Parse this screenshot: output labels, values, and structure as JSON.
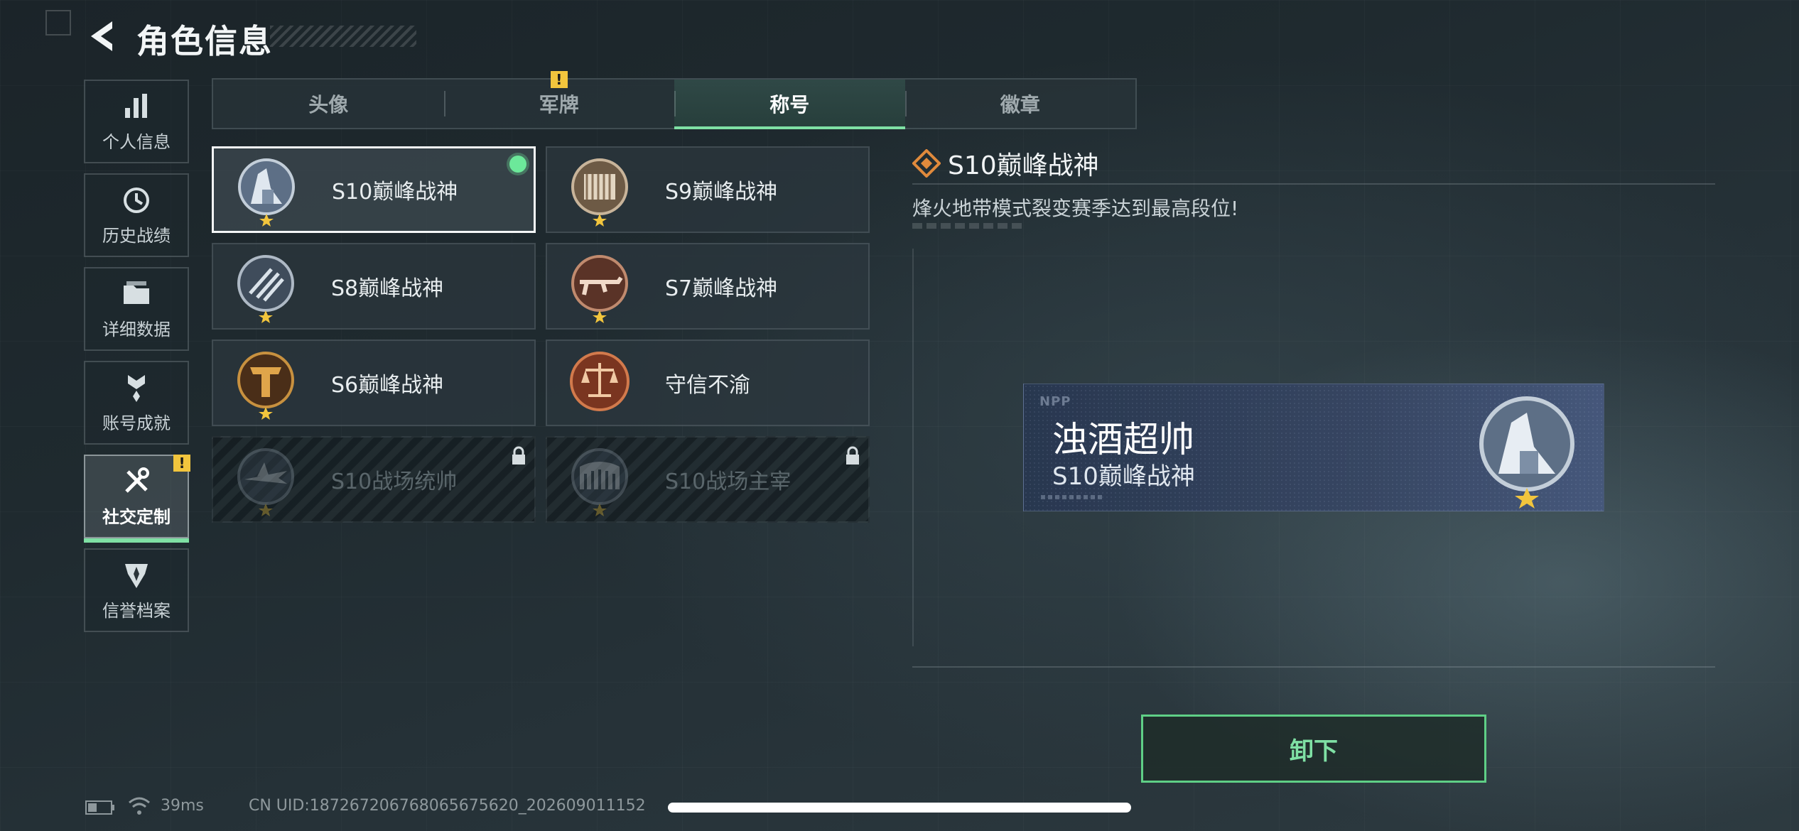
{
  "header": {
    "title": "角色信息"
  },
  "sidebar": {
    "items": [
      {
        "label": "个人信息",
        "icon": "bar-chart-icon"
      },
      {
        "label": "历史战绩",
        "icon": "history-clock-icon"
      },
      {
        "label": "详细数据",
        "icon": "folder-icon"
      },
      {
        "label": "账号成就",
        "icon": "achievement-icon"
      },
      {
        "label": "社交定制",
        "icon": "tools-icon",
        "active": true,
        "badge": "!"
      },
      {
        "label": "信誉档案",
        "icon": "credit-shield-icon"
      }
    ]
  },
  "tabs": [
    {
      "label": "头像"
    },
    {
      "label": "军牌",
      "badge": "!"
    },
    {
      "label": "称号",
      "active": true
    },
    {
      "label": "徽章"
    }
  ],
  "titles": [
    {
      "name": "S10巅峰战神",
      "selected": true,
      "equipped": true,
      "locked": false,
      "icon": "s10-emblem-icon"
    },
    {
      "name": "S9巅峰战神",
      "selected": false,
      "locked": false,
      "icon": "s9-emblem-icon"
    },
    {
      "name": "S8巅峰战神",
      "selected": false,
      "locked": false,
      "icon": "s8-emblem-icon"
    },
    {
      "name": "S7巅峰战神",
      "selected": false,
      "locked": false,
      "icon": "s7-emblem-icon"
    },
    {
      "name": "S6巅峰战神",
      "selected": false,
      "locked": false,
      "icon": "s6-emblem-icon"
    },
    {
      "name": "守信不渝",
      "selected": false,
      "locked": false,
      "icon": "scales-emblem-icon"
    },
    {
      "name": "S10战场统帅",
      "selected": false,
      "locked": true,
      "icon": "aircraft-emblem-icon"
    },
    {
      "name": "S10战场主宰",
      "selected": false,
      "locked": true,
      "icon": "colosseum-emblem-icon"
    }
  ],
  "detail": {
    "title": "S10巅峰战神",
    "description": "烽火地带模式裂变赛季达到最高段位!"
  },
  "preview": {
    "logo": "NPP",
    "player_name": "浊酒超帅",
    "title": "S10巅峰战神"
  },
  "actions": {
    "unequip": "卸下"
  },
  "status": {
    "ping": "39ms",
    "uid": "CN UID:1872672067680656756​20_202609011152"
  },
  "colors": {
    "accent": "#7fe0a4",
    "warning": "#f2c53d",
    "equipped": "#6ce89a"
  }
}
